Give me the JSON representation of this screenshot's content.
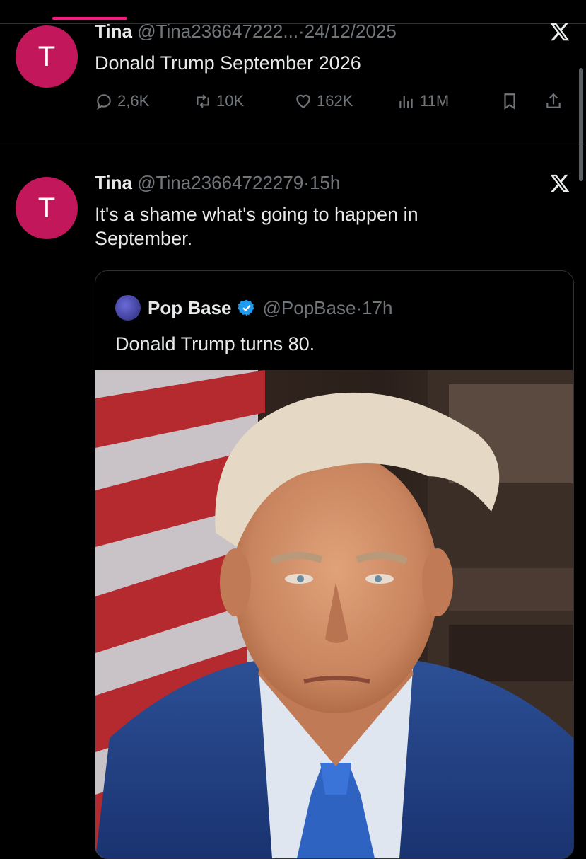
{
  "tweets": [
    {
      "avatar_letter": "T",
      "name": "Tina",
      "handle": "@Tina236647222...",
      "sep": "·",
      "time": "24/12/2025",
      "text": "Donald Trump September 2026",
      "stats": {
        "replies": "2,6K",
        "reposts": "10K",
        "likes": "162K",
        "views": "11M"
      }
    },
    {
      "avatar_letter": "T",
      "name": "Tina",
      "handle": "@Tina23664722279",
      "sep": "·",
      "time": "15h",
      "text": "It's a shame what's going to happen in September."
    }
  ],
  "quote": {
    "name": "Pop Base",
    "handle": "@PopBase",
    "sep": "·",
    "time": "17h",
    "text": "Donald Trump turns 80."
  },
  "icons": {
    "reply": "reply-icon",
    "repost": "repost-icon",
    "like": "heart-icon",
    "views": "views-icon",
    "bookmark": "bookmark-icon",
    "share": "share-icon",
    "x_logo": "x-logo-icon",
    "verified": "verified-badge-icon"
  },
  "colors": {
    "avatar": "#c2185b",
    "accent": "#f91880",
    "verified": "#1d9bf0",
    "muted": "#71767b"
  }
}
